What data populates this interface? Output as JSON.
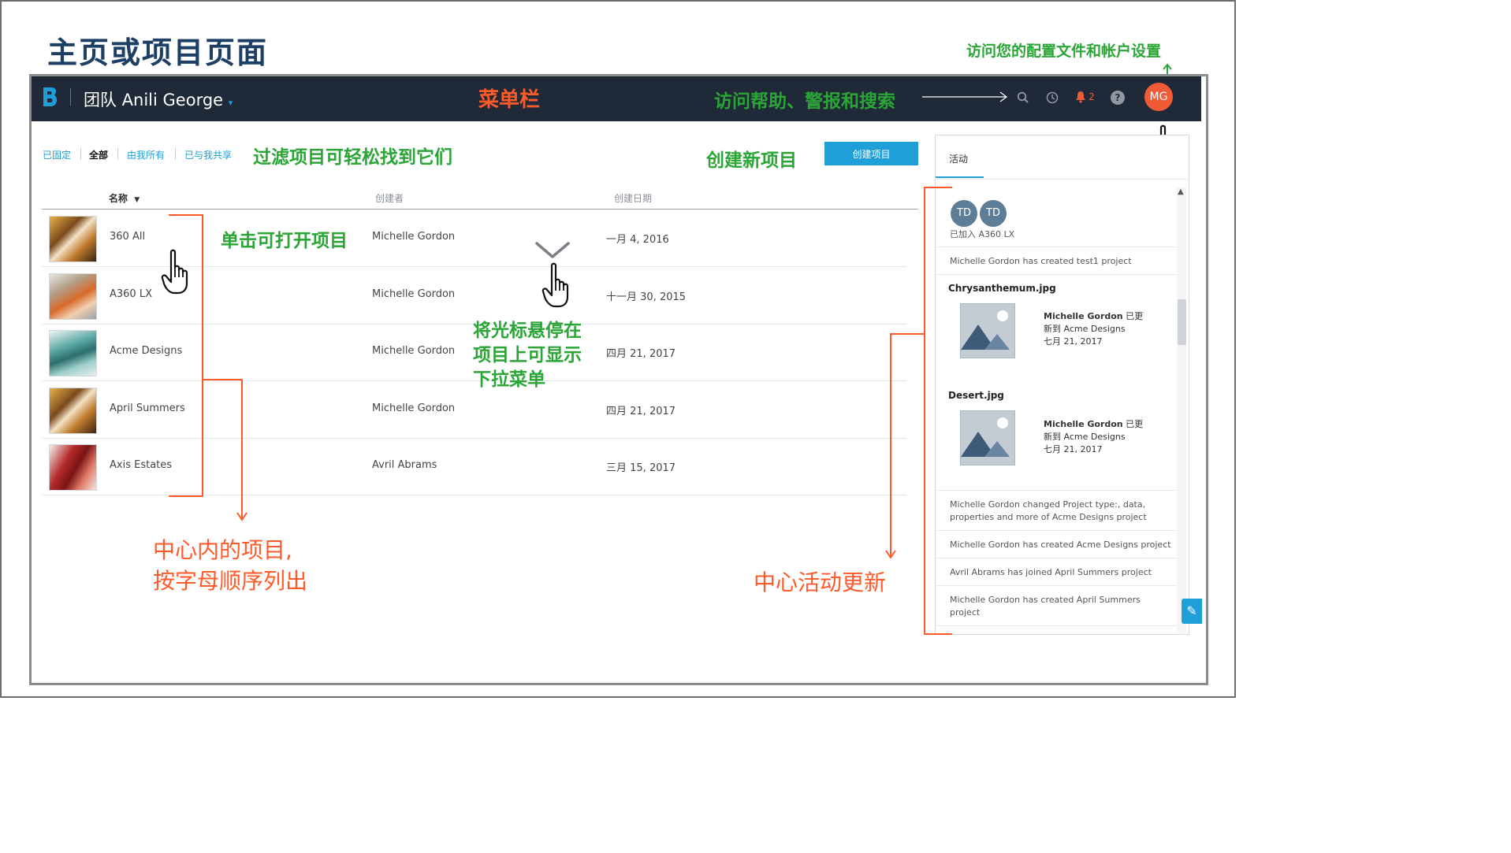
{
  "page_title": "主页或项目页面",
  "callouts": {
    "profile": "访问您的配置文件和帐户设置",
    "menu_bar": "菜单栏",
    "help_alerts_search": "访问帮助、警报和搜索",
    "filter": "过滤项目可轻松找到它们",
    "create_new": "创建新项目",
    "click_open": "单击可打开项目",
    "hover_line1": "将光标悬停在",
    "hover_line2": "项目上可显示",
    "hover_line3": "下拉菜单",
    "hub_projects_line1": "中心内的项目,",
    "hub_projects_line2": "按字母顺序列出",
    "hub_activity": "中心活动更新"
  },
  "navbar": {
    "team_label": "团队 Anili George",
    "alert_count": "2",
    "avatar_initials": "MG",
    "icons": [
      "search-icon",
      "clock-icon",
      "bell-icon",
      "help-icon"
    ]
  },
  "filters": {
    "pinned": "已固定",
    "all": "全部",
    "owned": "由我所有",
    "shared": "已与我共享",
    "active": "all"
  },
  "create_button": "创建项目",
  "table": {
    "columns": [
      "名称",
      "创建者",
      "创建日期"
    ],
    "rows": [
      {
        "name": "360 All",
        "creator": "Michelle Gordon",
        "date": "一月 4, 2016"
      },
      {
        "name": "A360 LX",
        "creator": "Michelle Gordon",
        "date": "十一月 30, 2015"
      },
      {
        "name": "Acme Designs",
        "creator": "Michelle Gordon",
        "date": "四月 21, 2017"
      },
      {
        "name": "April Summers",
        "creator": "Michelle Gordon",
        "date": "四月 21, 2017"
      },
      {
        "name": "Axis Estates",
        "creator": "Avril Abrams",
        "date": "三月 15, 2017"
      }
    ]
  },
  "activity": {
    "tab_label": "活动",
    "joined_initials": [
      "TD",
      "TD"
    ],
    "joined_text": "已加入 A360 LX",
    "items": [
      "Michelle Gordon has created test1 project",
      "Michelle Gordon changed Project type:, data, properties and more of Acme Designs project",
      "Michelle Gordon has created Acme Designs project",
      "Avril Abrams has joined April Summers project",
      "Michelle Gordon has created April Summers project"
    ],
    "files": [
      {
        "filename": "Chrysanthemum.jpg",
        "user": "Michelle Gordon",
        "action_1": "已更",
        "action_2": "新到 Acme Designs",
        "date": "七月 21, 2017"
      },
      {
        "filename": "Desert.jpg",
        "user": "Michelle Gordon",
        "action_1": "已更",
        "action_2": "新到 Acme Designs",
        "date": "七月 21, 2017"
      }
    ]
  },
  "colors": {
    "title_blue": "#1d3f66",
    "callout_green": "#2aa536",
    "callout_orange": "#ff5a2a",
    "navbar": "#1f2937",
    "accent_blue": "#1e9fd8",
    "avatar": "#f05a34"
  }
}
